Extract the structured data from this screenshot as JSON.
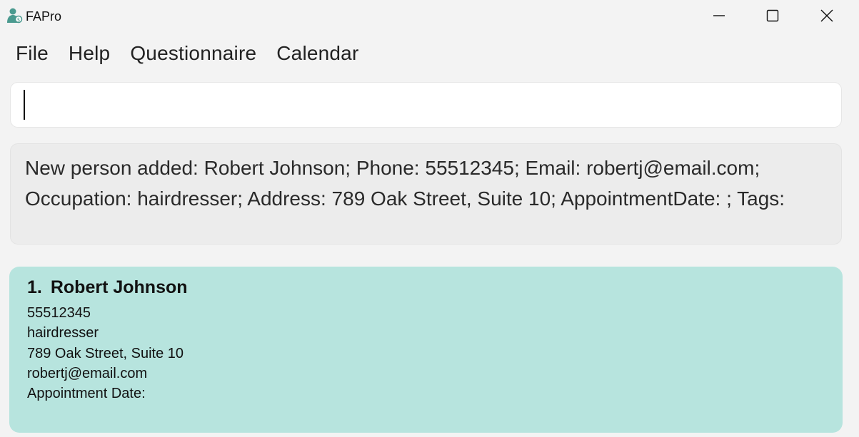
{
  "window": {
    "title": "FAPro",
    "controls": {
      "minimize": "minimize-icon",
      "maximize": "maximize-icon",
      "close": "close-icon"
    }
  },
  "menu": {
    "items": [
      {
        "label": "File"
      },
      {
        "label": "Help"
      },
      {
        "label": "Questionnaire"
      },
      {
        "label": "Calendar"
      }
    ]
  },
  "command": {
    "value": ""
  },
  "result": {
    "message": "New person added: Robert Johnson; Phone: 55512345; Email: robertj@email.com; Occupation: hairdresser; Address: 789 Oak Street, Suite 10; AppointmentDate: ; Tags:"
  },
  "persons": [
    {
      "index": "1.",
      "name": "Robert Johnson",
      "phone": "55512345",
      "occupation": "hairdresser",
      "address": "789 Oak Street, Suite 10",
      "email": "robertj@email.com",
      "appointment": "Appointment Date:"
    }
  ],
  "colors": {
    "background": "#f3f3f3",
    "card": "#b7e4de",
    "app_icon": "#4a9a8f"
  }
}
